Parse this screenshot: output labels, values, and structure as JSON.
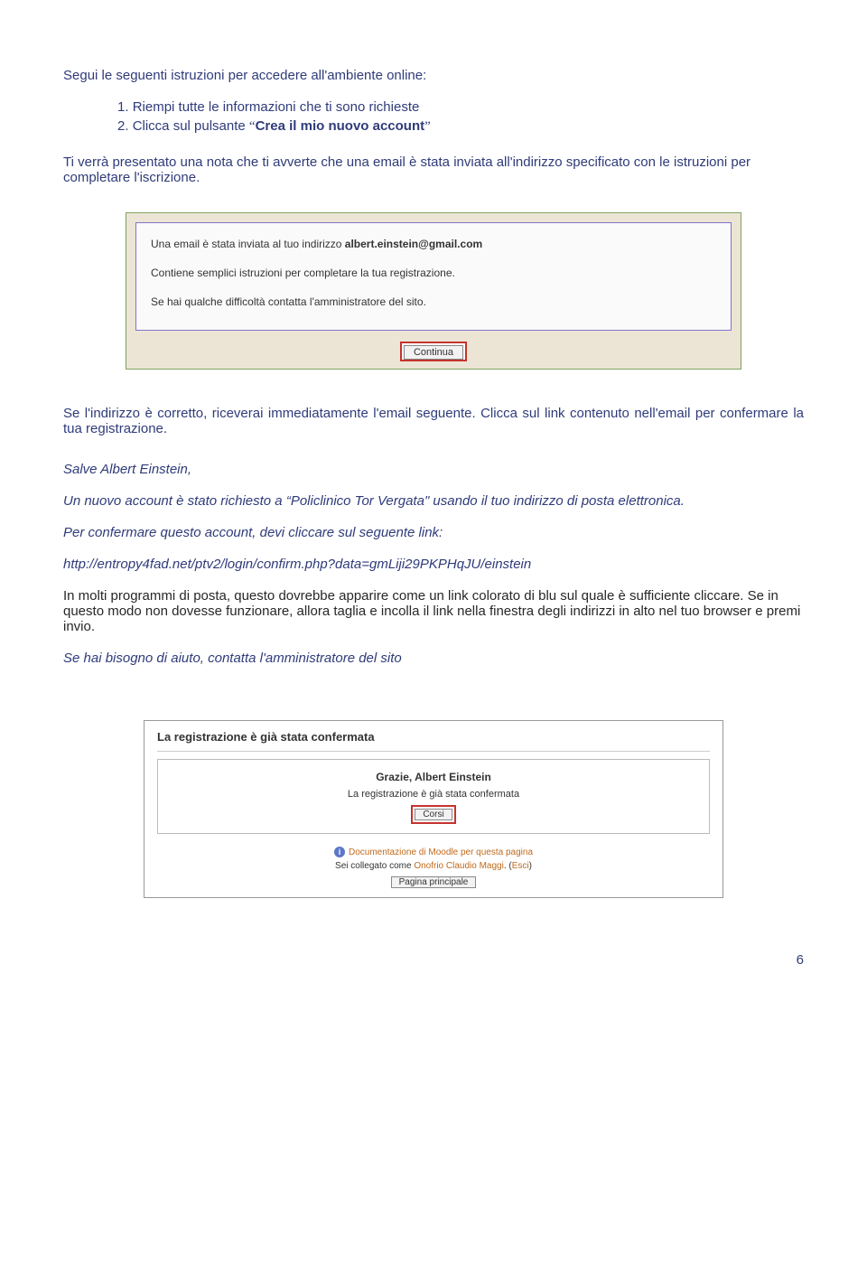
{
  "intro": "Segui le seguenti istruzioni per accedere all'ambiente online:",
  "steps": {
    "n1": "1.",
    "s1": "Riempi tutte le informazioni che ti sono richieste",
    "n2": "2.",
    "s2a": "Clicca sul pulsante ",
    "s2q1": "“",
    "s2b": "Crea il mio nuovo account",
    "s2q2": "”"
  },
  "para2": "Ti verrà presentato una nota che ti avverte che una email è stata inviata all'indirizzo specificato con le istruzioni per completare l'iscrizione.",
  "fig1": {
    "line1a": "Una email è stata inviata al tuo indirizzo ",
    "line1b": "albert.einstein@gmail.com",
    "line2": "Contiene semplici istruzioni per completare la tua registrazione.",
    "line3": "Se hai qualche difficoltà contatta l'amministratore del sito.",
    "btn": "Continua"
  },
  "para3": "Se l'indirizzo è corretto, riceverai immediatamente l'email seguente. Clicca sul link contenuto nell'email per confermare la tua registrazione.",
  "email": {
    "greet": "Salve Albert Einstein,",
    "body1a": "Un nuovo account è stato richiesto a ",
    "body1q": "“",
    "body1b": "Policlinico Tor Vergata\" usando il tuo indirizzo di posta elettronica.",
    "body2": "Per confermare questo account, devi cliccare sul seguente link:",
    "link": "http://entropy4fad.net/ptv2/login/confirm.php?data=gmLiji29PKPHqJU/einstein",
    "body3": "In molti programmi di posta, questo dovrebbe apparire come un link colorato di blu sul quale è sufficiente cliccare. Se in questo modo non dovesse funzionare, allora taglia e incolla il link nella finestra degli indirizzi in alto nel tuo browser e premi invio.",
    "body4": "Se hai bisogno di aiuto, contatta l'amministratore del sito"
  },
  "fig2": {
    "title": "La registrazione è già stata confermata",
    "thanks": "Grazie, Albert Einstein",
    "conf": "La registrazione è già stata confermata",
    "corsi": "Corsi",
    "doc": "Documentazione di Moodle per questa pagina",
    "user1": "Sei collegato come ",
    "user2": "Onofrio Claudio Maggi",
    "user3": ". (",
    "user4": "Esci",
    "user5": ")",
    "mainbtn": "Pagina principale"
  },
  "pagenum": "6"
}
